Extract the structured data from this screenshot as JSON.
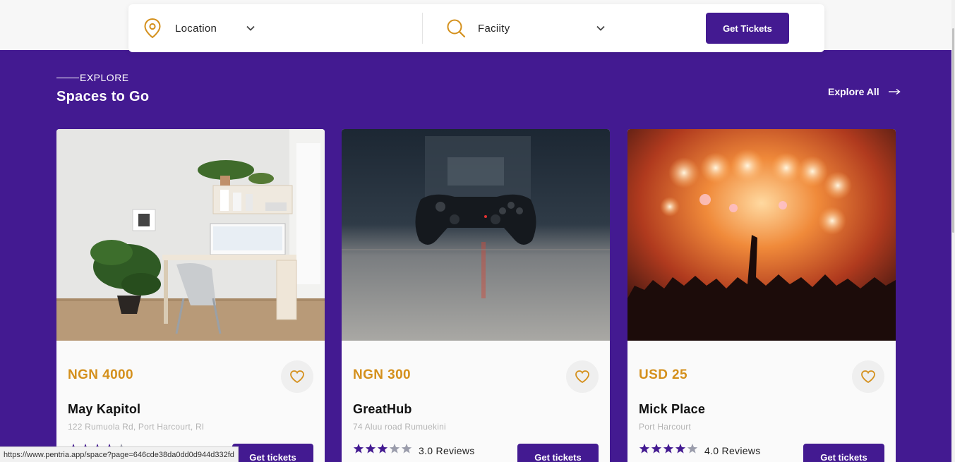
{
  "search": {
    "location_label": "Location",
    "facility_label": "Faciity",
    "get_tickets_label": "Get Tickets"
  },
  "section": {
    "tag": "EXPLORE",
    "title": "Spaces to Go",
    "explore_all": "Explore All"
  },
  "cards": [
    {
      "price": "NGN 4000",
      "name": "May Kapitol",
      "address": "122 Rumuola Rd, Port Harcourt, RI",
      "rating": 4,
      "reviews": "",
      "button": "Get tickets",
      "image": "home-office-photo"
    },
    {
      "price": "NGN 300",
      "name": "GreatHub",
      "address": "74 Aluu road Rumuekini",
      "rating": 3,
      "reviews": "3.0 Reviews",
      "button": "Get tickets",
      "image": "game-controller-photo"
    },
    {
      "price": "USD 25",
      "name": "Mick Place",
      "address": "Port Harcourt",
      "rating": 4,
      "reviews": "4.0 Reviews",
      "button": "Get tickets",
      "image": "concert-crowd-photo"
    }
  ],
  "status_bar": {
    "url": "https://www.pentria.app/space?page=646cde38da0dd0d944d332fd"
  },
  "colors": {
    "brand_purple": "#431a91",
    "price_gold": "#d4901c",
    "icon_gold": "#d4901c"
  }
}
